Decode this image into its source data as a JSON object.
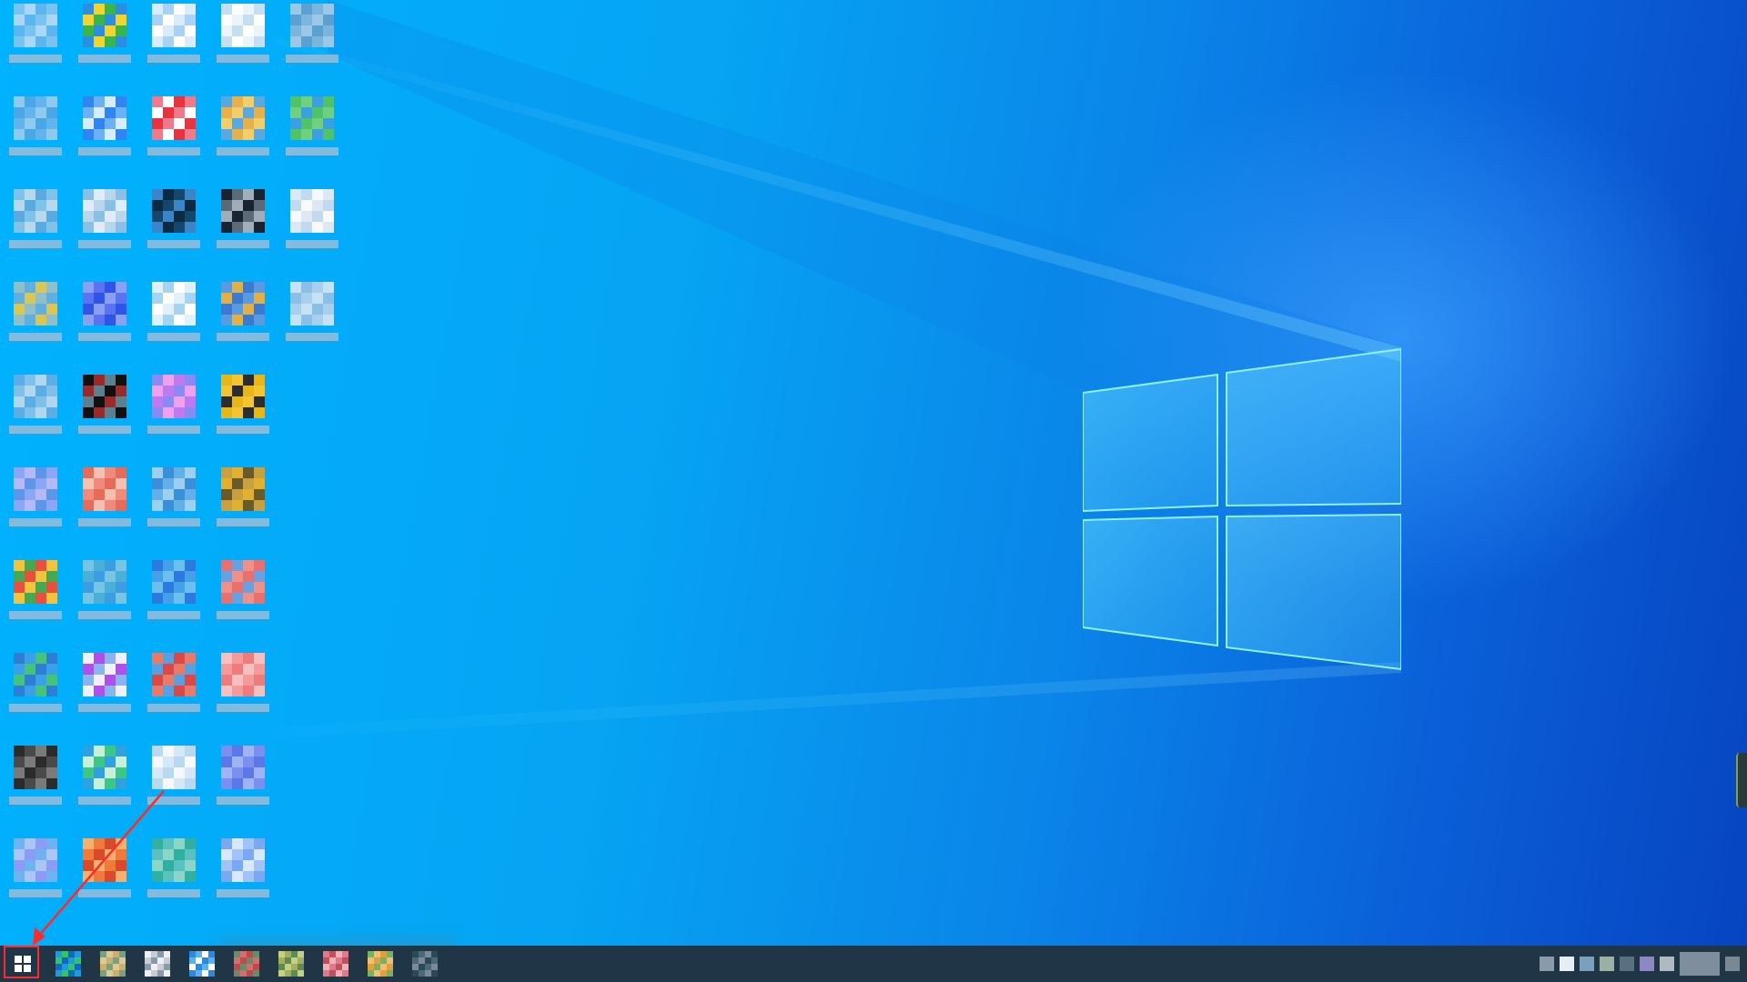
{
  "desktop": {
    "wallpaper": "windows-10-hero-light",
    "accent_colors": {
      "wallpaper_left": "#00b3ff",
      "wallpaper_right": "#0744c0",
      "taskbar": "#203646",
      "annotation": "#ff2a2a"
    },
    "icon_columns": [
      [
        {
          "icon": "app-icon",
          "colors": [
            "#5bb6f0",
            "#78c3f0",
            "#a8d8f5"
          ]
        },
        {
          "icon": "app-icon",
          "colors": [
            "#4aa7e6",
            "#62b5ec",
            "#8ec9f0"
          ]
        },
        {
          "icon": "app-icon",
          "colors": [
            "#7fc2ea",
            "#b6d9ee",
            "#5aa9df"
          ]
        },
        {
          "icon": "app-icon",
          "colors": [
            "#d9c65a",
            "#8fc0c9",
            "#5fb0e0"
          ]
        },
        {
          "icon": "app-icon",
          "colors": [
            "#7ec0ea",
            "#b0d7ef",
            "#5aaee5"
          ]
        },
        {
          "icon": "app-icon",
          "colors": [
            "#8aa6f4",
            "#b4b9f7",
            "#5f95e8"
          ]
        },
        {
          "icon": "app-icon",
          "colors": [
            "#e8503c",
            "#f1c43d",
            "#46a84f"
          ]
        },
        {
          "icon": "app-icon",
          "colors": [
            "#3aa0e8",
            "#45c37c",
            "#2d7fd3"
          ]
        },
        {
          "icon": "app-icon",
          "colors": [
            "#2b2b2b",
            "#4a4a4a",
            "#7a7a7a"
          ]
        },
        {
          "icon": "app-icon",
          "colors": [
            "#8b9cf5",
            "#6fb2f0",
            "#a9c6f7"
          ]
        }
      ],
      [
        {
          "icon": "app-icon",
          "colors": [
            "#f2d431",
            "#3ab54a",
            "#2b8fe0"
          ]
        },
        {
          "icon": "app-icon",
          "colors": [
            "#2f86f0",
            "#6ab2f5",
            "#d6ecff"
          ]
        },
        {
          "icon": "app-icon",
          "colors": [
            "#b9d6ea",
            "#8bc0e6",
            "#ddeefa"
          ]
        },
        {
          "icon": "app-icon",
          "colors": [
            "#5a73f0",
            "#2f55e8",
            "#8aa0f5"
          ]
        },
        {
          "icon": "app-icon",
          "colors": [
            "#111111",
            "#9a2a2a",
            "#5f7f8f"
          ]
        },
        {
          "icon": "app-icon",
          "colors": [
            "#f08a7a",
            "#e66b5a",
            "#f5c0b0"
          ]
        },
        {
          "icon": "app-icon",
          "colors": [
            "#4ab0d8",
            "#3c9ee0",
            "#76c4e6"
          ]
        },
        {
          "icon": "app-icon",
          "colors": [
            "#f0f0ff",
            "#b050e8",
            "#8ab4f0"
          ]
        },
        {
          "icon": "app-icon",
          "colors": [
            "#3cc787",
            "#2fa0e0",
            "#c6f0d8"
          ]
        },
        {
          "icon": "app-icon",
          "colors": [
            "#f07a3a",
            "#d84a2a",
            "#f5b070"
          ]
        }
      ],
      [
        {
          "icon": "app-icon",
          "colors": [
            "#d9ecfb",
            "#a9d1f5",
            "#ffffff"
          ]
        },
        {
          "icon": "app-icon",
          "colors": [
            "#e8343f",
            "#f07a8a",
            "#ffffff"
          ]
        },
        {
          "icon": "app-icon",
          "colors": [
            "#0b2a44",
            "#15476d",
            "#3a86c8"
          ]
        },
        {
          "icon": "app-icon",
          "colors": [
            "#dff1fb",
            "#a6d3ef",
            "#ffffff"
          ]
        },
        {
          "icon": "app-icon",
          "colors": [
            "#c07af0",
            "#8a8af5",
            "#f0a0f0"
          ]
        },
        {
          "icon": "app-icon",
          "colors": [
            "#3a90d8",
            "#62b0e6",
            "#9cd0f0"
          ]
        },
        {
          "icon": "app-icon",
          "colors": [
            "#2a7ae0",
            "#45a0ea",
            "#6cc0f0"
          ]
        },
        {
          "icon": "app-icon",
          "colors": [
            "#d84a4a",
            "#e87a6a",
            "#5aa0e0"
          ]
        },
        {
          "icon": "app-icon",
          "colors": [
            "#f5f9ff",
            "#d5e8f7",
            "#b9d9f0"
          ]
        },
        {
          "icon": "app-icon",
          "colors": [
            "#2fb0a0",
            "#5ac0c0",
            "#8ad6c8"
          ]
        }
      ],
      [
        {
          "icon": "app-icon",
          "colors": [
            "#eaf4fb",
            "#c4dff2",
            "#ffffff"
          ]
        },
        {
          "icon": "app-icon",
          "colors": [
            "#e8b04a",
            "#f0cf6a",
            "#5aa8e0"
          ]
        },
        {
          "icon": "app-icon",
          "colors": [
            "#1a2430",
            "#5a6a78",
            "#a0aebb"
          ]
        },
        {
          "icon": "app-icon",
          "colors": [
            "#3a7ad0",
            "#5a9ae0",
            "#e0b04a"
          ]
        },
        {
          "icon": "app-icon",
          "colors": [
            "#f2c531",
            "#2d2d2d",
            "#e6b71a"
          ]
        },
        {
          "icon": "app-icon",
          "colors": [
            "#c8a040",
            "#e0b030",
            "#6a5a2a"
          ]
        },
        {
          "icon": "app-icon",
          "colors": [
            "#f0908a",
            "#e87070",
            "#6aa0e0"
          ]
        },
        {
          "icon": "app-icon",
          "colors": [
            "#f59a9a",
            "#ee7c7c",
            "#f7c0c0"
          ]
        },
        {
          "icon": "app-icon",
          "colors": [
            "#7a90f0",
            "#5a78e8",
            "#a0b4f5"
          ]
        },
        {
          "icon": "app-icon",
          "colors": [
            "#a0c4f8",
            "#7aa8f2",
            "#d8e8ff"
          ]
        }
      ],
      [
        {
          "icon": "app-icon",
          "colors": [
            "#5aa0d0",
            "#7ab6dc",
            "#9ac8e6"
          ]
        },
        {
          "icon": "app-icon",
          "colors": [
            "#4fc36a",
            "#6fd080",
            "#3aa0e0"
          ]
        },
        {
          "icon": "app-icon",
          "colors": [
            "#f7f9fc",
            "#dce9f5",
            "#c1daf0"
          ]
        },
        {
          "icon": "app-icon",
          "colors": [
            "#8ac0e6",
            "#a8d0ee",
            "#c6e2f5"
          ]
        }
      ]
    ]
  },
  "taskbar": {
    "start": {
      "icon": "windows-start-icon"
    },
    "pinned_apps": [
      {
        "icon": "edge-browser-icon",
        "colors": [
          "#1d9bdc",
          "#35c36a",
          "#0f6cbd"
        ]
      },
      {
        "icon": "app-icon",
        "colors": [
          "#c8b070",
          "#7aa080",
          "#e0c890"
        ]
      },
      {
        "icon": "app-icon",
        "colors": [
          "#c8ccd4",
          "#8a9aa8",
          "#eef0f4"
        ]
      },
      {
        "icon": "store-icon",
        "colors": [
          "#2a8ae0",
          "#5ab0f0",
          "#ffffff"
        ]
      },
      {
        "icon": "app-icon",
        "colors": [
          "#c04a4a",
          "#6a8a6a",
          "#d07070"
        ]
      },
      {
        "icon": "app-icon",
        "colors": [
          "#a0b060",
          "#608a50",
          "#c8d080"
        ]
      },
      {
        "icon": "app-icon",
        "colors": [
          "#e07a8a",
          "#c05060",
          "#f0b0b8"
        ]
      },
      {
        "icon": "app-icon",
        "colors": [
          "#e0a040",
          "#7ab060",
          "#f0c070"
        ]
      },
      {
        "icon": "app-icon",
        "colors": [
          "#4a6a7a",
          "#7a8a9a",
          "#2a4a5a"
        ]
      }
    ],
    "tray_items": [
      {
        "icon": "tray-icon",
        "color": "#8a9aa8"
      },
      {
        "icon": "tray-icon",
        "color": "#e6eef5"
      },
      {
        "icon": "tray-icon",
        "color": "#7aa0c0"
      },
      {
        "icon": "tray-icon",
        "color": "#9ab0a0"
      },
      {
        "icon": "tray-icon",
        "color": "#5a7080"
      },
      {
        "icon": "tray-icon",
        "color": "#8a8ac0"
      },
      {
        "icon": "tray-icon",
        "color": "#b0b8c0"
      },
      {
        "icon": "clock-area",
        "color": "#a8b4c0"
      },
      {
        "icon": "notification-icon",
        "color": "#7a8894"
      }
    ]
  }
}
